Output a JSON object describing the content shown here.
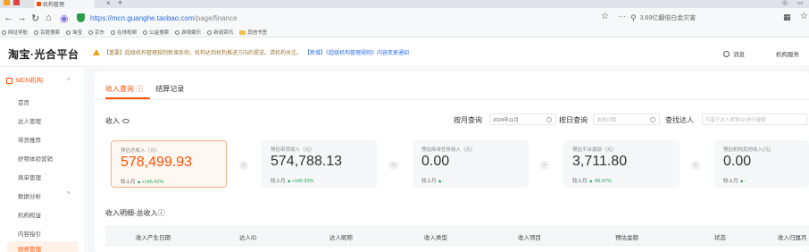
{
  "browser": {
    "tab_title": "机构管理",
    "tab_close": "×",
    "tab_new": "+",
    "url_host": "https://mcn.guanghe.taobao.com",
    "url_path": "/page/finance",
    "search_text": "3.69亿翻倍白金灾害",
    "bookmarks": [
      "网址导航",
      "百度搜索",
      "淘宝",
      "京东",
      "在线视频",
      "公益搜索",
      "游戏娱乐",
      "新闻资讯"
    ],
    "bookmark_folder": "其他书签"
  },
  "header": {
    "brand": "淘宝·光合平台",
    "notice_tag": "【重要】",
    "notice_text": "超级机构管理规则新增条例，机构达到机构推进方向的提送。请机构关注。",
    "notice_link": "【新增】《超级机构管理规则》内容变更通知",
    "messages": "消息",
    "org_service": "机构服务"
  },
  "sidebar": {
    "top": "MCN机构",
    "items": [
      "首页",
      "达人管理",
      "带货推荐",
      "好物体验营销",
      "商单管理",
      "数据分析",
      "机构权益",
      "内容指引"
    ],
    "active": "财务管理"
  },
  "main": {
    "tabs": [
      "收入查询",
      "结算记录"
    ],
    "tab_help": "ⓘ",
    "section_title": "收入",
    "filters": {
      "by_month_label": "按月查询",
      "month_value": "2024年11月",
      "by_day_label": "按日查询",
      "day_placeholder": "选择日期",
      "find_label": "查找达人",
      "find_placeholder": "可基于达人昵称/ID进行搜索"
    },
    "metrics": [
      {
        "label": "预估总收入（元）",
        "value": "578,499.93",
        "compare": "较上月",
        "change": "+145.42%"
      },
      {
        "label": "预估带货收入（元）",
        "value": "574,788.13",
        "compare": "较上月",
        "change": "+145.93%"
      },
      {
        "label": "预估商单任务收入（元）",
        "value": "0.00",
        "compare": "较上月",
        "change": "-"
      },
      {
        "label": "预估平台激励（元）",
        "value": "3,711.80",
        "compare": "较上月",
        "change": "-85.97%"
      },
      {
        "label": "预估机构其他收入(元)",
        "value": "0.00",
        "compare": "较上月",
        "change": "-"
      }
    ],
    "detail_title": "收入明细-总收入ⓘ",
    "columns": [
      "收入产生日期",
      "达人ID",
      "达人昵称",
      "收入类型",
      "收入项目",
      "预估金额",
      "状态",
      "收入归属月"
    ]
  }
}
